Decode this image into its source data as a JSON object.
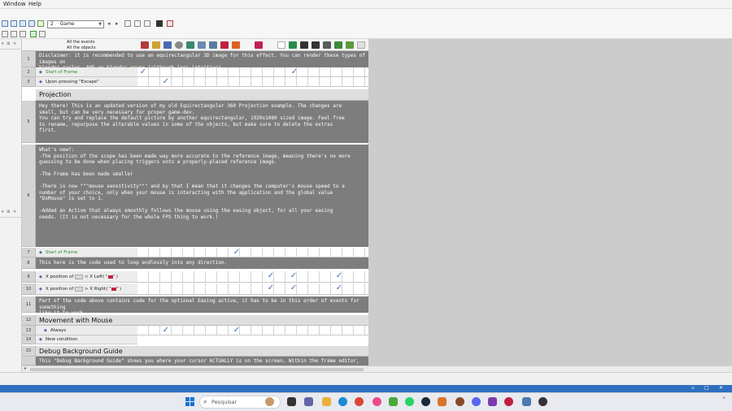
{
  "menubar": {
    "window": "Window",
    "help": "Help"
  },
  "toolbar": {
    "frame_number": "2",
    "frame_name": "Game"
  },
  "header": {
    "all_events": "All the events",
    "all_objects": "All the objects"
  },
  "rows": {
    "r1": {
      "num": "1",
      "text": "Disclaimer: it is recommended to use an equirectangular 3D image for this effect. You can render these types of images on\nblender cycles, AND on blender eevee (although less intuitive)."
    },
    "r2": {
      "num": "2",
      "cond": "Start of Frame"
    },
    "r3": {
      "num": "3",
      "cond": "Upon pressing \"Escape\""
    },
    "r4": {
      "title": "Projection"
    },
    "r5": {
      "num": "5",
      "text": "Hey there! This is an updated version of my old Equirectangular 360 Projection example. The changes are\nsmall, but can be very necessary for proper game-dev.\nYou can try and replace the default picture by another equirectangular, 1920x1080 sized image. Feel free\nto rename, repurpose the alterable values in some of the objects, but make sure to delete the extras\nfirst."
    },
    "r6": {
      "num": "6",
      "text": "What's new?:\n-The position of the scope has been made way more accurate to the reference image, meaning there's no more\nguessing to be done when placing triggers onto a properly-placed reference image.\n\n-The Frame has been made smaller\n\n-There is now \"\"\"mouse sensitivity\"\"\" and by that I mean that it changes the computer's mouse speed to a\nnumber of your choice, only when your mouse is interacting with the application and the global value\n\"DoMouse\" is set to 1.\n\n-Added an Active that always smoothly follows the mouse using the easing object, for all your easing\nneeds. (It is not necessary for the whole FPS thing to work.)"
    },
    "r7": {
      "num": "7",
      "cond": "Start of Frame"
    },
    "r8": {
      "num": "8",
      "text": "This here is the code used to loop endlessly into any direction."
    },
    "r9": {
      "num": "9",
      "cond_a": "X position of",
      "cond_b": "< X Left( \"",
      "cond_c": "\" )"
    },
    "r10": {
      "num": "10",
      "cond_a": "X position of",
      "cond_b": "> X Right( \"",
      "cond_c": "\" )"
    },
    "r11": {
      "num": "11",
      "text": "Part of the code above contains code for the optional Easing active, it has to be in this order of events for something\nlike it to work"
    },
    "r12": {
      "num": "12",
      "title": "Movement with Mouse"
    },
    "r13": {
      "num": "13",
      "cond": "Always"
    },
    "r14": {
      "num": "14",
      "cond": "New condition"
    },
    "r15": {
      "num": "15",
      "title": "Debug Background Guide"
    },
    "r16": {
      "text": "This \"Debug Background Guide\" shows you where your cursor ACTUALLY is on the screen. Within the frame editor, you can"
    }
  },
  "taskbar": {
    "search_placeholder": "Pesquisar"
  },
  "colors": {
    "check": "#3f72b5",
    "comment_bg": "#7d7d7d",
    "taskbar_accent": "#2f6fbf"
  }
}
